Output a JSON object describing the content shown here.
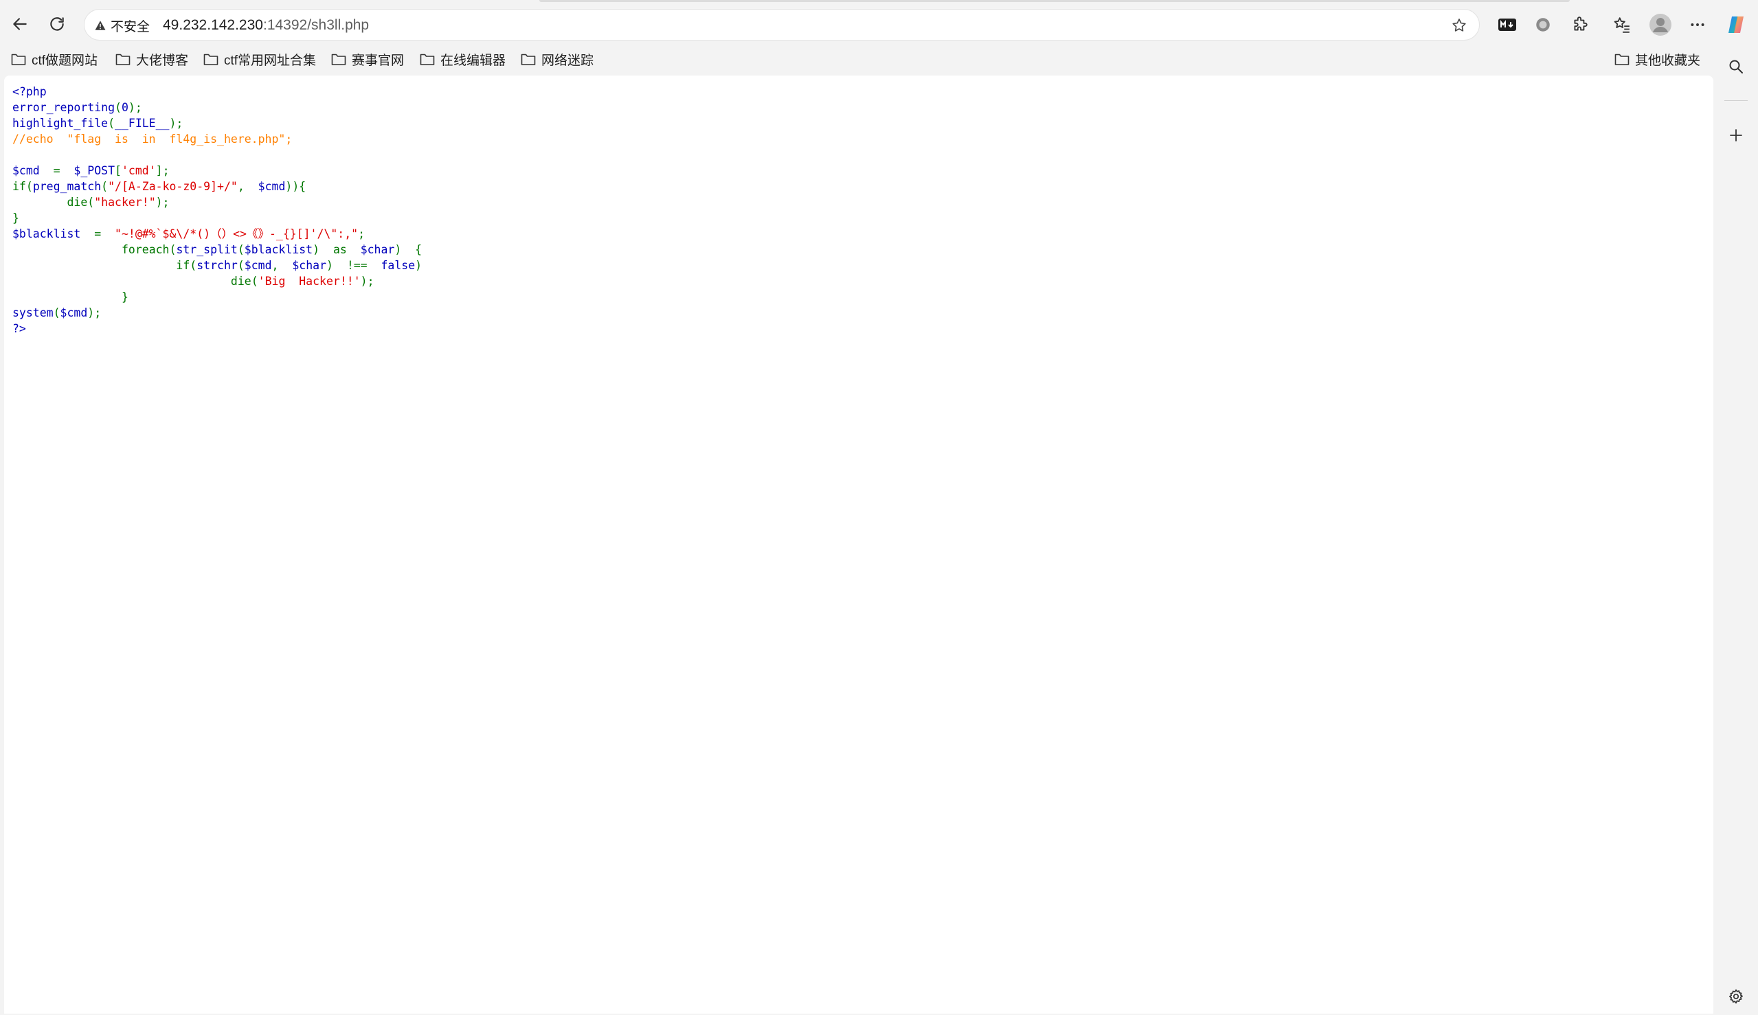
{
  "browser": {
    "security_label": "不安全",
    "url_host": "49.232.142.230",
    "url_rest": ":14392/sh3ll.php"
  },
  "bookmarks": [
    {
      "label": "ctf做题网站"
    },
    {
      "label": "大佬博客"
    },
    {
      "label": "ctf常用网址合集"
    },
    {
      "label": "赛事官网"
    },
    {
      "label": "在线编辑器"
    },
    {
      "label": "网络迷踪"
    }
  ],
  "other_bookmarks": "其他收藏夹",
  "code": {
    "l1": "<?php",
    "l2_fn": "error_reporting",
    "l2_p1": "(",
    "l2_arg": "0",
    "l2_p2": ");",
    "l3_fn": "highlight_file",
    "l3_p1": "(",
    "l3_arg": "__FILE__",
    "l3_p2": ");",
    "l4": "//echo  \"flag  is  in  fl4g_is_here.php\";",
    "l6_var": "$cmd",
    "l6_eq": "  =  ",
    "l6_post": "$_POST",
    "l6_br1": "[",
    "l6_key": "'cmd'",
    "l6_br2": "];",
    "l7_if": "if(",
    "l7_fn": "preg_match",
    "l7_p1": "(",
    "l7_re": "\"/[A-Za-ko-z0-9]+/\"",
    "l7_comma": ",  ",
    "l7_var": "$cmd",
    "l7_p2": ")){",
    "l8_die": "        die(",
    "l8_str": "\"hacker!\"",
    "l8_end": ");",
    "l9": "}",
    "l10_var": "$blacklist",
    "l10_eq": "  =  ",
    "l10_str": "\"~!@#%`$&\\/*()（）<>《》-_{}[]'/\\\":,\"",
    "l10_end": ";",
    "l11_indent": "                ",
    "l11_kw": "foreach(",
    "l11_fn": "str_split",
    "l11_p1": "(",
    "l11_var": "$blacklist",
    "l11_p2": ")  ",
    "l11_as": "as  ",
    "l11_var2": "$char",
    "l11_p3": ")  {",
    "l12_indent": "                        ",
    "l12_kw": "if(",
    "l12_fn": "strchr",
    "l12_p1": "(",
    "l12_var": "$cmd",
    "l12_comma": ",  ",
    "l12_var2": "$char",
    "l12_p2": ")  !==  ",
    "l12_false": "false",
    "l12_p3": ")",
    "l13_indent": "                                ",
    "l13_die": "die(",
    "l13_str": "'Big  Hacker!!'",
    "l13_end": ");",
    "l14": "                }",
    "l15_fn": "system",
    "l15_p1": "(",
    "l15_var": "$cmd",
    "l15_p2": ");",
    "l16": "?>"
  }
}
